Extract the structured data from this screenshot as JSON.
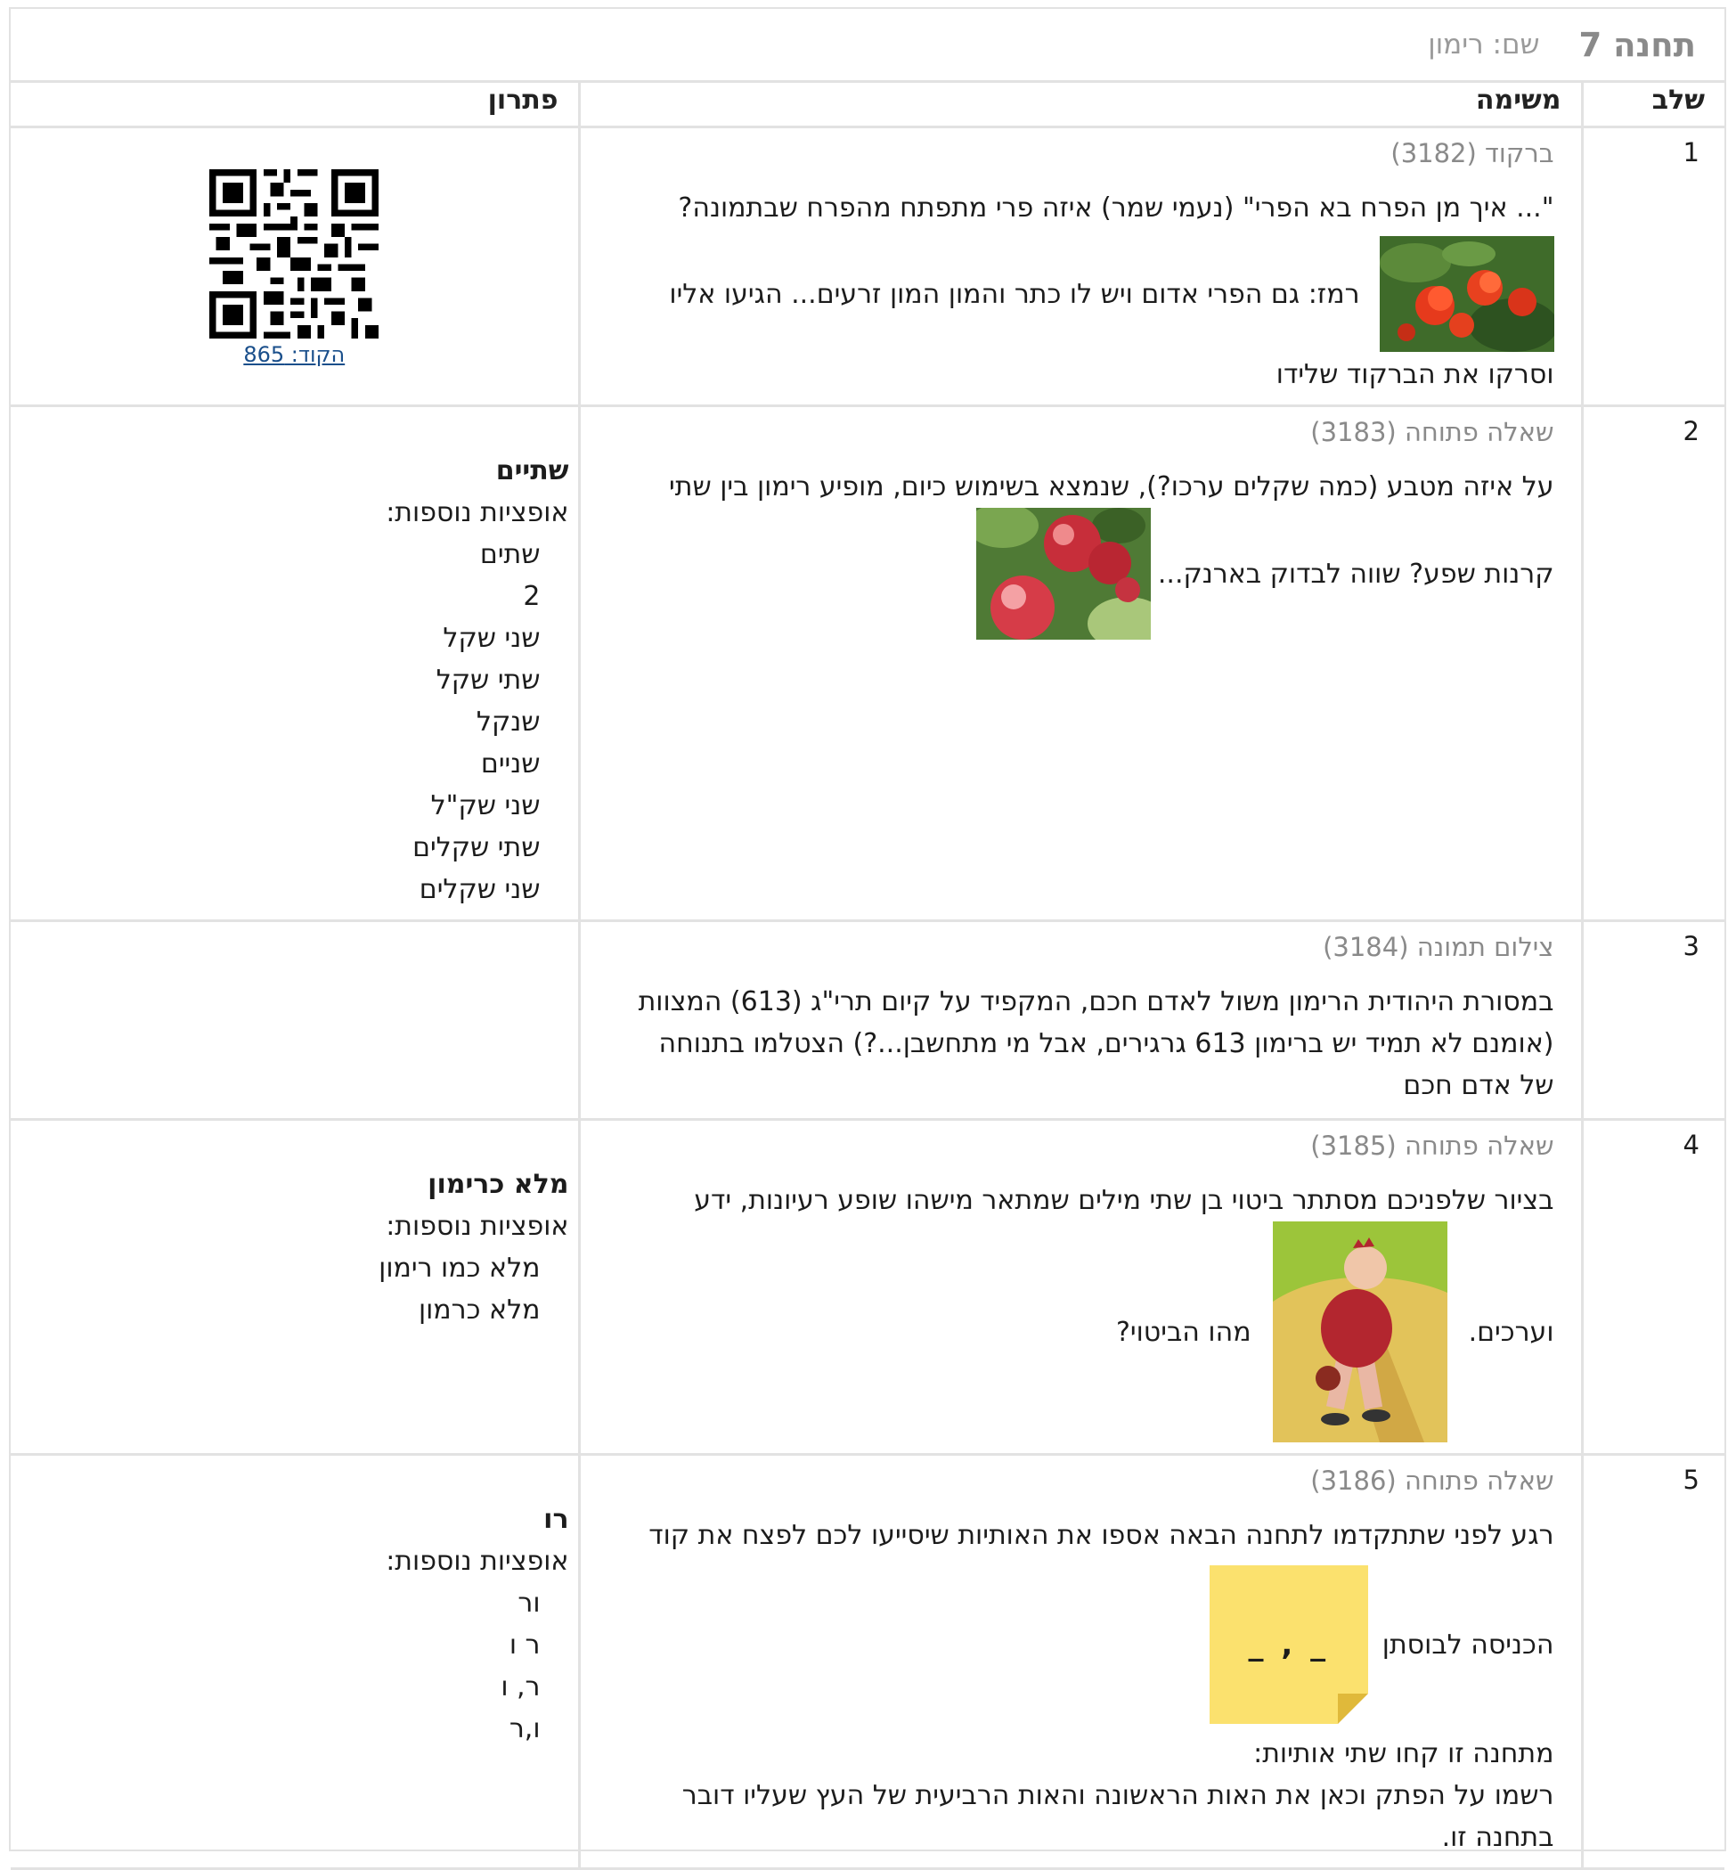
{
  "station": {
    "title": "תחנה 7",
    "name": "שם: רימון"
  },
  "headers": {
    "step": "שלב",
    "task": "משימה",
    "solution": "פתרון"
  },
  "rows": [
    {
      "step": "1",
      "kind": "ברקוד (3182)",
      "line1": "\"... איך מן הפרח בא הפרי\" (נעמי שמר)   איזה פרי מתפתח מהפרח שבתמונה?",
      "line2a": "רמז: גם הפרי אדום ויש לו כתר והמון המון זרעים...   הגיעו אליו",
      "line3": "וסרקו את הברקוד שלידו",
      "qr_label": "הקוד: 865"
    },
    {
      "step": "2",
      "kind": "שאלה פתוחה (3183)",
      "line1": "על איזה מטבע (כמה שקלים ערכו?), שנמצא בשימוש כיום, מופיע רימון בין שתי",
      "line2a": "קרנות שפע?   שווה לבדוק בארנק...",
      "answer": "שתיים",
      "more": "אופציות נוספות:",
      "options": [
        "שתים",
        "2",
        "שני שקל",
        "שתי שקל",
        "שנקל",
        "שניים",
        "שני שק\"ל",
        "שתי שקלים",
        "שני שקלים"
      ]
    },
    {
      "step": "3",
      "kind": "צילום תמונה (3184)",
      "lines": [
        "במסורת היהודית הרימון משול לאדם חכם, המקפיד על קיום תרי\"ג (613) המצוות",
        "(אומנם לא תמיד יש ברימון 613 גרגירים, אבל מי מתחשבן...?)   הצטלמו בתנוחה",
        "של אדם חכם"
      ]
    },
    {
      "step": "4",
      "kind": "שאלה פתוחה (3185)",
      "line1": "בציור שלפניכם מסתתר ביטוי בן שתי מילים שמתאר מישהו שופע רעיונות, ידע",
      "line2a": "וערכים.",
      "line2b": "מהו הביטוי?",
      "answer": "מלא כרימון",
      "more": "אופציות נוספות:",
      "options": [
        "מלא כמו רימון",
        "מלא כרמון"
      ]
    },
    {
      "step": "5",
      "kind": "שאלה פתוחה (3186)",
      "line1": "רגע לפני שתתקדמו לתחנה הבאה אספו את האותיות שיסייעו לכם לפצח את קוד",
      "line2a": "הכניסה לבוסתן",
      "note": "_ , _",
      "lines": [
        "מתחנה זו קחו שתי אותיות:",
        "רשמו על הפתק וכאן את האות הראשונה והאות הרביעית של העץ שעליו דובר",
        "בתחנה זו."
      ],
      "answer": "רו",
      "more": "אופציות נוספות:",
      "options": [
        "ור",
        "ר ו",
        "ר, ו",
        "ו,ר"
      ]
    }
  ]
}
